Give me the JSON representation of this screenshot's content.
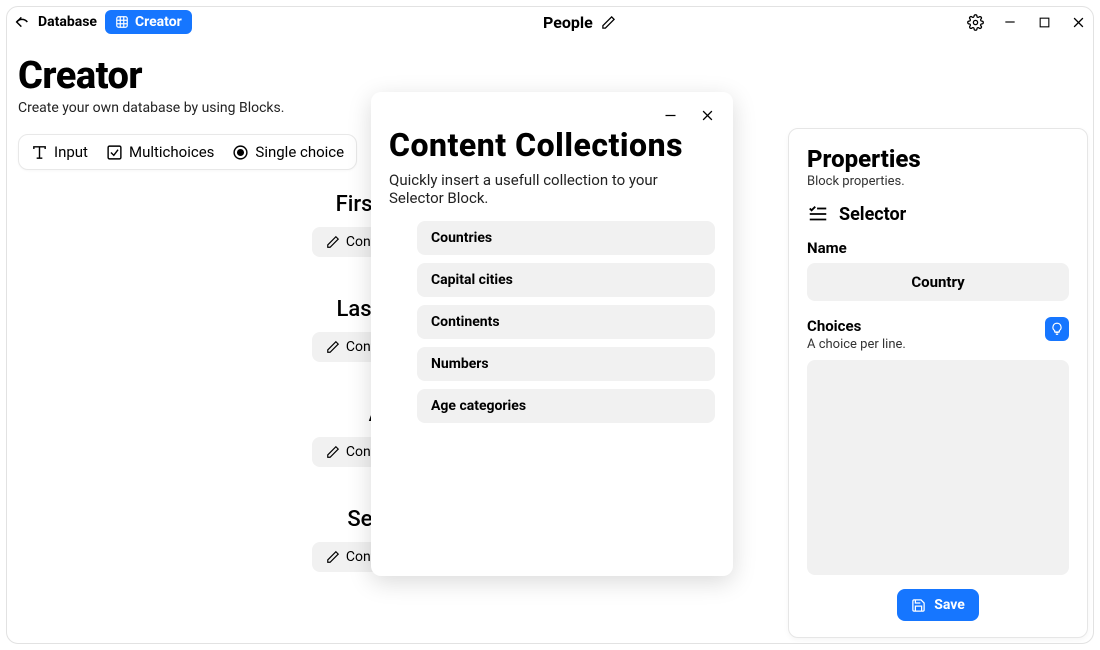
{
  "titlebar": {
    "nav_database": "Database",
    "nav_creator": "Creator",
    "doc_title": "People"
  },
  "page": {
    "title": "Creator",
    "subtitle": "Create your own database by using Blocks."
  },
  "toolbar": {
    "input": "Input",
    "multichoices": "Multichoices",
    "single_choice": "Single choice"
  },
  "blocks": [
    {
      "title": "First name",
      "configure": "Configure"
    },
    {
      "title": "Last name",
      "configure": "Configure"
    },
    {
      "title": "Age",
      "configure": "Configure"
    },
    {
      "title": "Selector",
      "configure": "Configure"
    }
  ],
  "modal": {
    "title": "Content Collections",
    "subtitle": "Quickly insert a usefull collection to your Selector Block.",
    "items": [
      "Countries",
      "Capital cities",
      "Continents",
      "Numbers",
      "Age categories"
    ]
  },
  "panel": {
    "title": "Properties",
    "subtitle": "Block properties.",
    "type_label": "Selector",
    "name_label": "Name",
    "name_value": "Country",
    "choices_label": "Choices",
    "choices_hint": "A choice per line.",
    "choices_value": "",
    "save": "Save"
  }
}
